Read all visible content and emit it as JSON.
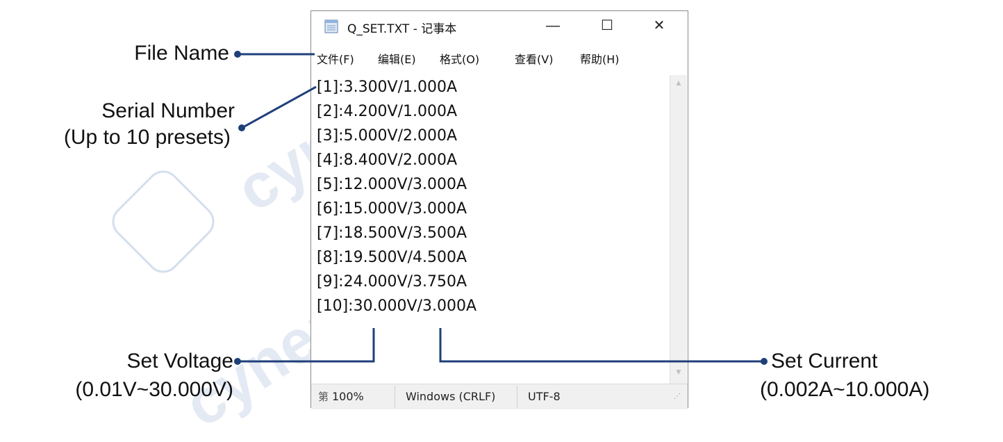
{
  "window": {
    "title": "Q_SET.TXT - 记事本",
    "controls": {
      "minimize": "—",
      "maximize": "☐",
      "close": "✕"
    }
  },
  "menu": [
    "文件(F)",
    "编辑(E)",
    "格式(O)",
    "查看(V)",
    "帮助(H)"
  ],
  "lines": [
    "[1]:3.300V/1.000A",
    "[2]:4.200V/1.000A",
    "[3]:5.000V/2.000A",
    "[4]:8.400V/2.000A",
    "[5]:12.000V/3.000A",
    "[6]:15.000V/3.000A",
    "[7]:18.500V/3.500A",
    "[8]:19.500V/4.500A",
    "[9]:24.000V/3.750A",
    "[10]:30.000V/3.000A"
  ],
  "status": {
    "zoom": "100%",
    "line_ending": "Windows (CRLF)",
    "encoding": "UTF-8",
    "cursor_glyph": "第"
  },
  "annotations": {
    "file_name": "File Name",
    "serial_number": "Serial Number",
    "serial_number_note": "(Up to 10 presets)",
    "set_voltage": "Set Voltage",
    "set_voltage_range": "(0.01V~30.000V)",
    "set_current": "Set Current",
    "set_current_range": "(0.002A~10.000A)"
  },
  "watermark": {
    "brand_text": "cynep"
  },
  "colors": {
    "annotation_line": "#1f3f7a",
    "accent": "#1f3f7a",
    "watermark": "#9fb6d6"
  }
}
